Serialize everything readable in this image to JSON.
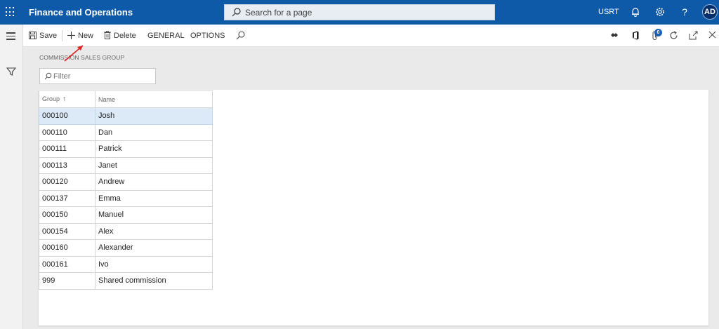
{
  "header": {
    "app_title": "Finance and Operations",
    "search_placeholder": "Search for a page",
    "company": "USRT",
    "help_glyph": "?",
    "avatar_initials": "AD",
    "bar_color": "#0f5aa8"
  },
  "actions": {
    "save": "Save",
    "new": "New",
    "delete": "Delete",
    "general": "GENERAL",
    "options": "OPTIONS",
    "attachments_badge": "0"
  },
  "content": {
    "section_label": "COMMISSION SALES GROUP",
    "filter_placeholder": "Filter",
    "columns": [
      "Group",
      "Name"
    ],
    "sort_glyph": "↑",
    "rows": [
      {
        "group": "000100",
        "name": "Josh",
        "selected": true
      },
      {
        "group": "000110",
        "name": "Dan"
      },
      {
        "group": "000111",
        "name": "Patrick"
      },
      {
        "group": "000113",
        "name": "Janet"
      },
      {
        "group": "000120",
        "name": "Andrew"
      },
      {
        "group": "000137",
        "name": "Emma"
      },
      {
        "group": "000150",
        "name": "Manuel"
      },
      {
        "group": "000154",
        "name": "Alex"
      },
      {
        "group": "000160",
        "name": "Alexander"
      },
      {
        "group": "000161",
        "name": "Ivo"
      },
      {
        "group": "999",
        "name": "Shared commission"
      }
    ]
  },
  "icons": [
    "waffle-icon",
    "search-icon",
    "bell-icon",
    "gear-icon",
    "help-icon",
    "hamburger-icon",
    "filter-icon",
    "save-icon",
    "plus-icon",
    "trash-icon",
    "diamond-icon",
    "office-icon",
    "attachment-icon",
    "refresh-icon",
    "popout-icon",
    "close-icon"
  ],
  "annotation_color": "#e02020"
}
